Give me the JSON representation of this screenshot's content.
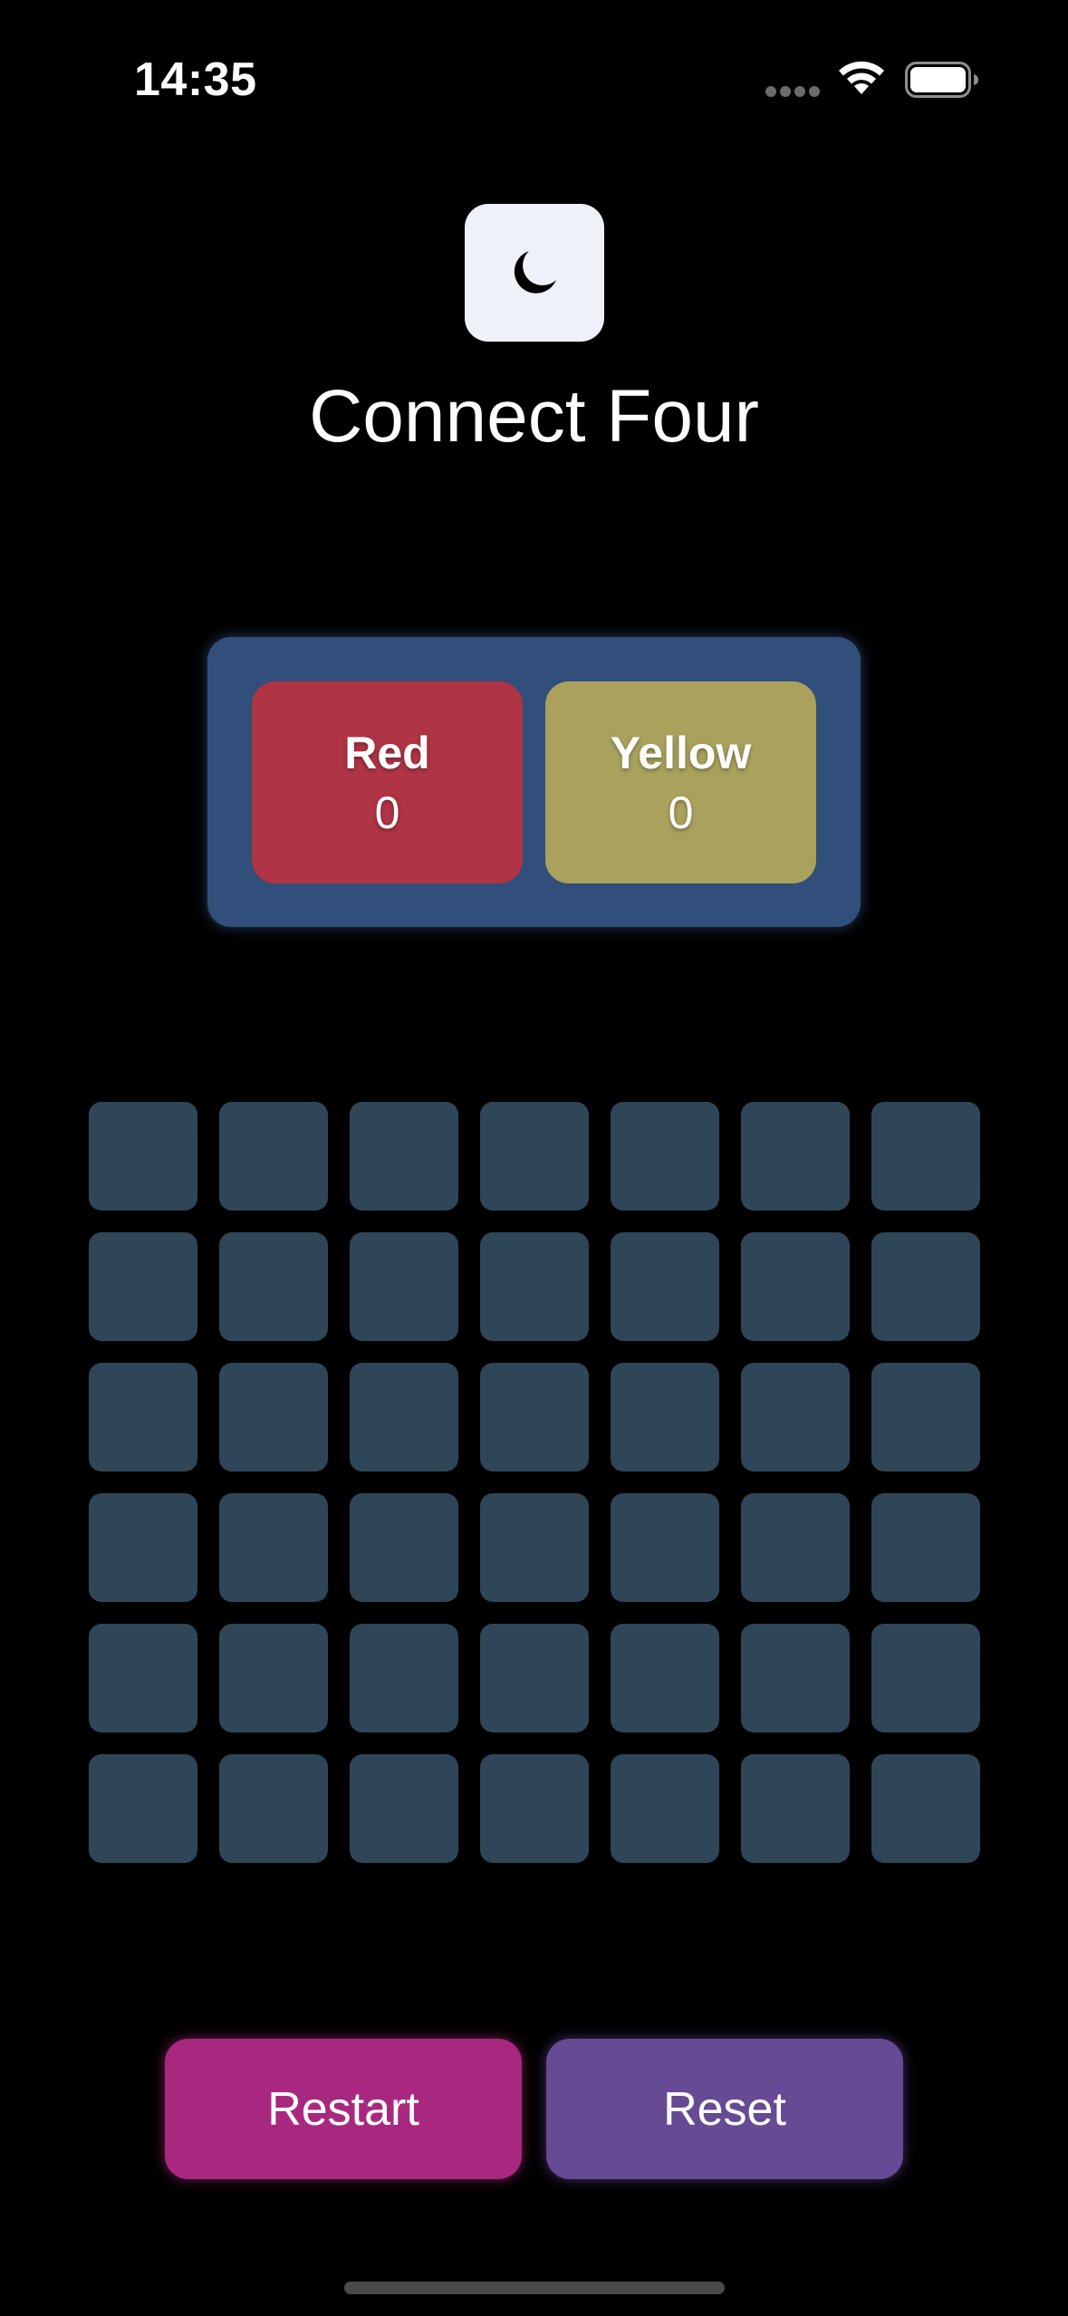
{
  "status_bar": {
    "time": "14:35",
    "wifi_icon": "wifi-icon",
    "battery_icon": "battery-icon"
  },
  "theme_toggle": {
    "icon": "moon-icon"
  },
  "title": "Connect Four",
  "scoreboard": {
    "players": [
      {
        "name": "Red",
        "score": "0",
        "color": "#af3444"
      },
      {
        "name": "Yellow",
        "score": "0",
        "color": "#a9a15c"
      }
    ]
  },
  "board": {
    "columns": 7,
    "rows": 6,
    "empty_cell_color": "#2e4658",
    "cells": [
      [
        "",
        "",
        "",
        "",
        "",
        "",
        ""
      ],
      [
        "",
        "",
        "",
        "",
        "",
        "",
        ""
      ],
      [
        "",
        "",
        "",
        "",
        "",
        "",
        ""
      ],
      [
        "",
        "",
        "",
        "",
        "",
        "",
        ""
      ],
      [
        "",
        "",
        "",
        "",
        "",
        "",
        ""
      ],
      [
        "",
        "",
        "",
        "",
        "",
        "",
        ""
      ]
    ]
  },
  "actions": {
    "restart_label": "Restart",
    "reset_label": "Reset"
  },
  "colors": {
    "background": "#000000",
    "scoreboard_bg": "#324e7a",
    "restart": "#a9287f",
    "reset": "#664a94"
  }
}
